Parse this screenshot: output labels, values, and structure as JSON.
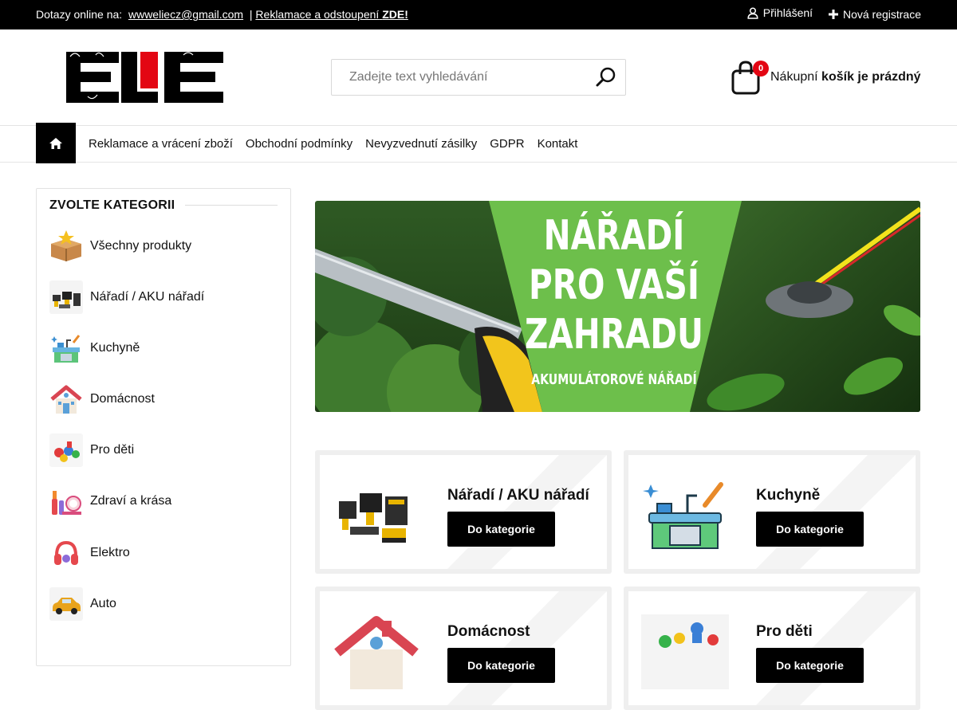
{
  "topbar": {
    "contact_prefix": "Dotazy online na:",
    "email": "wwweliecz@gmail.com",
    "separator": "|",
    "returns_text": "Reklamace a odstoupení",
    "returns_strong": "ZDE!",
    "login_label": "Přihlášení",
    "register_label": "Nová registrace"
  },
  "logo": {
    "text": "ELIE"
  },
  "search": {
    "placeholder": "Zadejte text vyhledávání"
  },
  "cart": {
    "count": "0",
    "label_prefix": "Nákupní",
    "label_strong": "košík je prázdný"
  },
  "nav": {
    "items": [
      "Reklamace a vrácení zboží",
      "Obchodní podmínky",
      "Nevyzvednutí zásilky",
      "GDPR",
      "Kontakt"
    ]
  },
  "sidebar": {
    "title": "ZVOLTE KATEGORII",
    "categories": [
      {
        "label": "Všechny produkty",
        "icon": "box-star-icon"
      },
      {
        "label": "Nářadí / AKU nářadí",
        "icon": "tools-icon"
      },
      {
        "label": "Kuchyně",
        "icon": "kitchen-icon"
      },
      {
        "label": "Domácnost",
        "icon": "house-icon"
      },
      {
        "label": "Pro děti",
        "icon": "toys-icon"
      },
      {
        "label": "Zdraví a krása",
        "icon": "cosmetics-icon"
      },
      {
        "label": "Elektro",
        "icon": "headphones-icon"
      },
      {
        "label": "Auto",
        "icon": "car-icon"
      }
    ]
  },
  "banner": {
    "line1": "NÁŘADÍ",
    "line2": "PRO VAŠÍ",
    "line3": "ZAHRADU",
    "subtitle": "AKUMULÁTOROVÉ NÁŘADÍ",
    "accent": "#6dbf4b"
  },
  "cards": [
    {
      "title": "Nářadí / AKU nářadí",
      "button": "Do kategorie"
    },
    {
      "title": "Kuchyně",
      "button": "Do kategorie"
    },
    {
      "title": "Domácnost",
      "button": "Do kategorie"
    },
    {
      "title": "Pro děti",
      "button": "Do kategorie"
    }
  ]
}
